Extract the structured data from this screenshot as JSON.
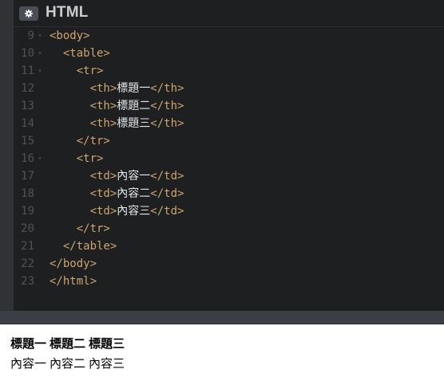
{
  "panel": {
    "title": "HTML",
    "settings_icon": "gear-icon"
  },
  "editor": {
    "lines": [
      {
        "num": "9",
        "fold": "▾",
        "indent": "",
        "tag": "<body>",
        "text": "",
        "close": ""
      },
      {
        "num": "10",
        "fold": "▾",
        "indent": "  ",
        "tag": "<table>",
        "text": "",
        "close": ""
      },
      {
        "num": "11",
        "fold": "▾",
        "indent": "    ",
        "tag": "<tr>",
        "text": "",
        "close": ""
      },
      {
        "num": "12",
        "fold": "",
        "indent": "      ",
        "tag": "<th>",
        "text": "標題一",
        "close": "</th>"
      },
      {
        "num": "13",
        "fold": "",
        "indent": "      ",
        "tag": "<th>",
        "text": "標題二",
        "close": "</th>"
      },
      {
        "num": "14",
        "fold": "",
        "indent": "      ",
        "tag": "<th>",
        "text": "標題三",
        "close": "</th>"
      },
      {
        "num": "15",
        "fold": "",
        "indent": "    ",
        "tag": "</tr>",
        "text": "",
        "close": ""
      },
      {
        "num": "16",
        "fold": "▾",
        "indent": "    ",
        "tag": "<tr>",
        "text": "",
        "close": ""
      },
      {
        "num": "17",
        "fold": "",
        "indent": "      ",
        "tag": "<td>",
        "text": "內容一",
        "close": "</td>"
      },
      {
        "num": "18",
        "fold": "",
        "indent": "      ",
        "tag": "<td>",
        "text": "內容二",
        "close": "</td>"
      },
      {
        "num": "19",
        "fold": "",
        "indent": "      ",
        "tag": "<td>",
        "text": "內容三",
        "close": "</td>"
      },
      {
        "num": "20",
        "fold": "",
        "indent": "    ",
        "tag": "</tr>",
        "text": "",
        "close": ""
      },
      {
        "num": "21",
        "fold": "",
        "indent": "  ",
        "tag": "</table>",
        "text": "",
        "close": ""
      },
      {
        "num": "22",
        "fold": "",
        "indent": "",
        "tag": "</body>",
        "text": "",
        "close": ""
      },
      {
        "num": "23",
        "fold": "",
        "indent": "",
        "tag": "</html>",
        "text": "",
        "close": ""
      }
    ]
  },
  "preview": {
    "headers": [
      "標題一",
      "標題二",
      "標題三"
    ],
    "cells": [
      "內容一",
      "內容二",
      "內容三"
    ]
  },
  "colors": {
    "editor_bg": "#1d1f20",
    "tag": "#cfa46e",
    "text": "#e4e6e8",
    "line_number": "#4f535a",
    "panel_title": "#c9ccd1"
  }
}
